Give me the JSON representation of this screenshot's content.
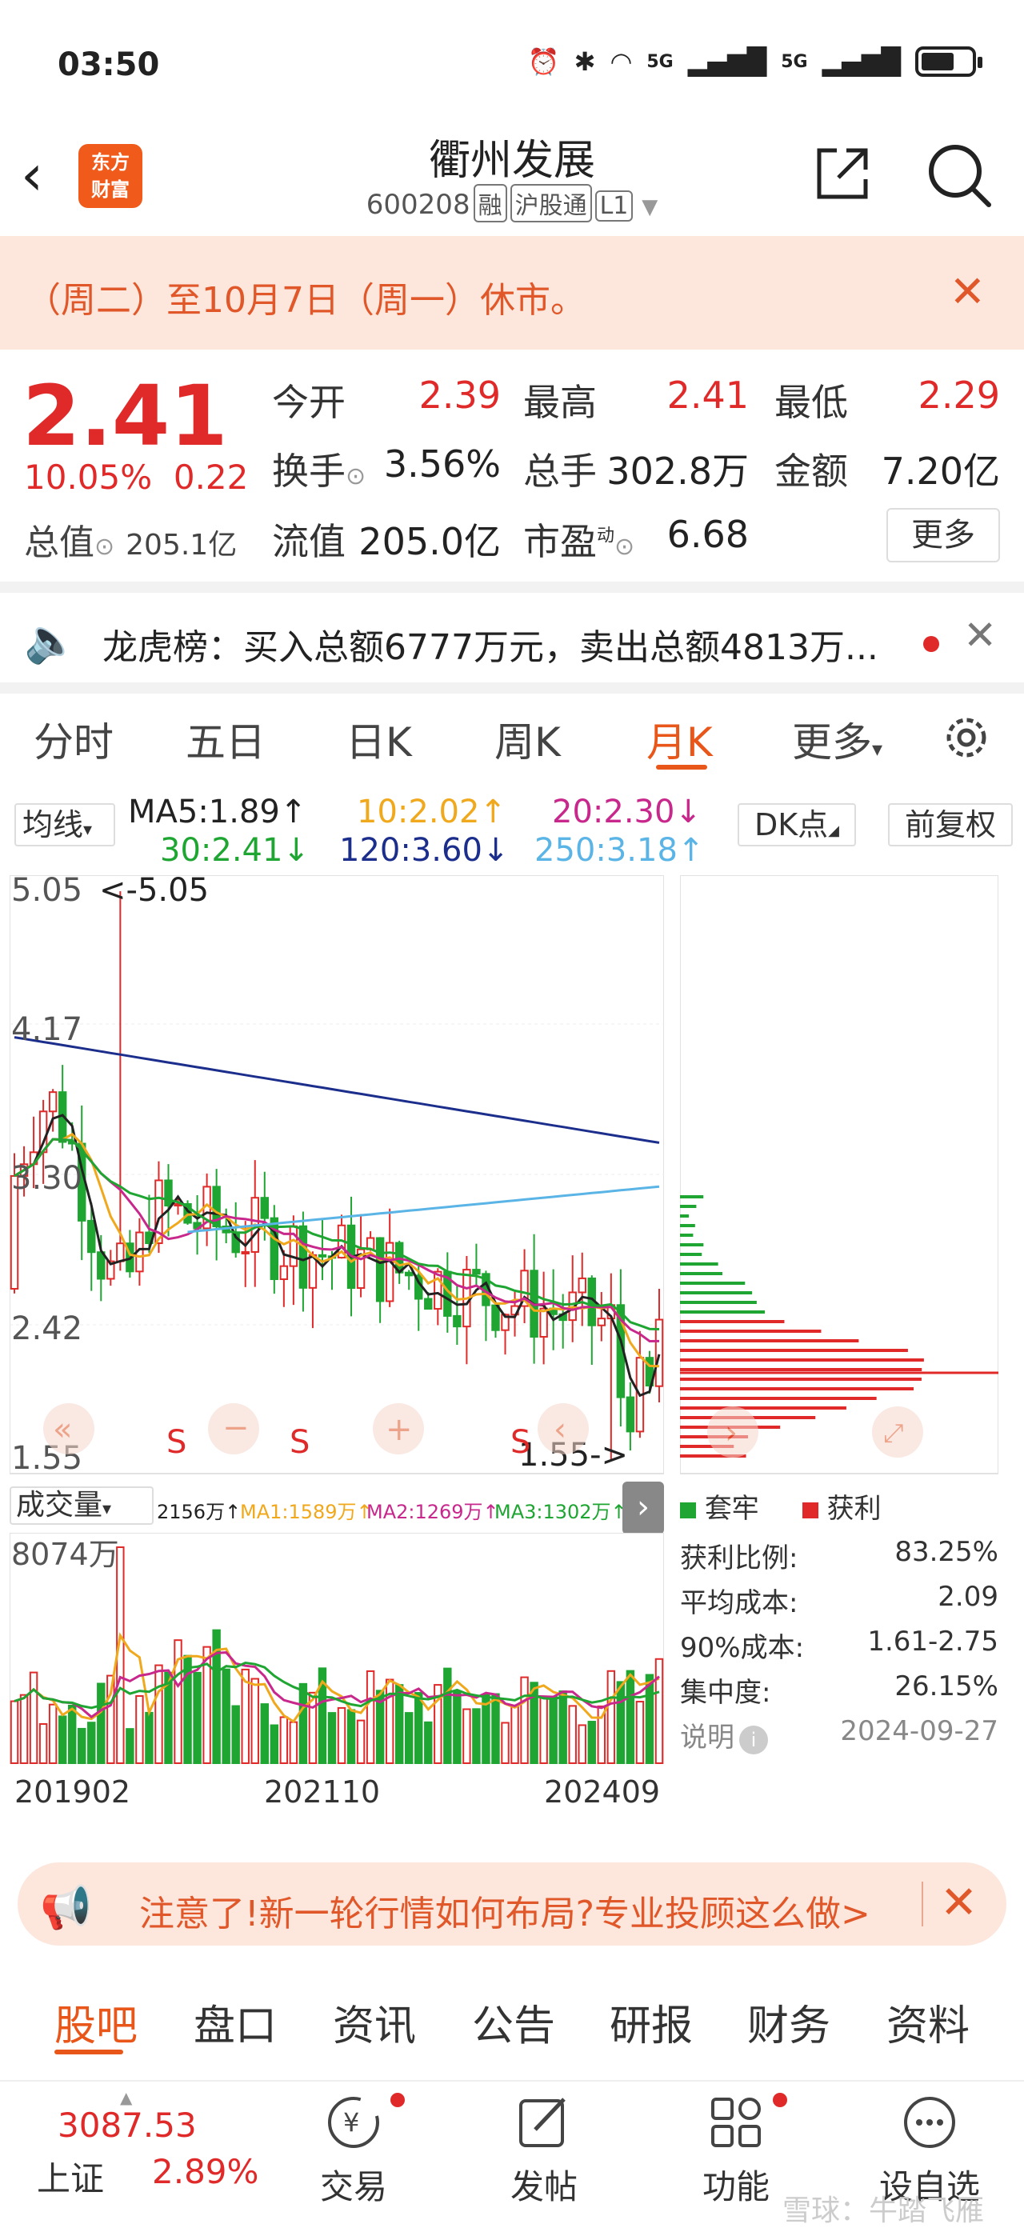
{
  "status_bar": {
    "time": "03:50",
    "network": "5G",
    "network2": "5G"
  },
  "header": {
    "logo": "东方\n财富",
    "name": "衢州发展",
    "code": "600208",
    "tags": [
      "融",
      "沪股通",
      "L1"
    ]
  },
  "notice": {
    "text": "（周二）至10月7日（周一）休市。"
  },
  "quote": {
    "price": "2.41",
    "change_pct": "10.05%",
    "change_abs": "0.22",
    "mktcap_label": "总值",
    "mktcap_value": "205.1亿",
    "fields": [
      {
        "label": "今开",
        "value": "2.39",
        "color": "#e02a2a"
      },
      {
        "label": "最高",
        "value": "2.41",
        "color": "#e02a2a"
      },
      {
        "label": "最低",
        "value": "2.29",
        "color": "#e02a2a"
      },
      {
        "label": "换手",
        "value": "3.56%",
        "color": "#222222"
      },
      {
        "label": "总手",
        "value": "302.8万",
        "color": "#222222"
      },
      {
        "label": "金额",
        "value": "7.20亿",
        "color": "#222222"
      },
      {
        "label": "流值",
        "value": "205.0亿",
        "color": "#222222"
      },
      {
        "label": "市盈",
        "value": "6.68",
        "color": "#222222",
        "sup": "动"
      }
    ],
    "more": "更多"
  },
  "dragon_tiger": {
    "text": "龙虎榜：买入总额6777万元，卖出总额4813万..."
  },
  "kline_tabs": {
    "tabs": [
      "分时",
      "五日",
      "日K",
      "周K",
      "月K",
      "更多"
    ],
    "active": "月K"
  },
  "ma_row": {
    "selector": "均线",
    "items": [
      {
        "text": "MA5:1.89↑",
        "color": "#222222"
      },
      {
        "text": "10:2.02↑",
        "color": "#f0a81c"
      },
      {
        "text": "20:2.30↓",
        "color": "#c8288c"
      },
      {
        "text": "30:2.41↓",
        "color": "#1fa532"
      },
      {
        "text": "120:3.60↓",
        "color": "#1c2e8c"
      },
      {
        "text": "250:3.18↑",
        "color": "#5ab4e6"
      }
    ],
    "dk_button": "DK点",
    "adjust_button": "前复权"
  },
  "kchart": {
    "y_labels": [
      "5.05",
      "4.17",
      "3.30",
      "2.42",
      "1.55"
    ],
    "max_mark": "<-5.05",
    "min_mark": "1.55->",
    "signal": "S"
  },
  "volume": {
    "selector": "成交量",
    "stats": [
      {
        "text": "2156万↑",
        "color": "#222222"
      },
      {
        "text": "MA1:1589万↑",
        "color": "#f0a81c"
      },
      {
        "text": "MA2:1269万↑",
        "color": "#c8288c"
      },
      {
        "text": "MA3:1302万↑",
        "color": "#1fa532"
      }
    ],
    "max_label": "8074万",
    "x_labels": [
      "201902",
      "202110",
      "202409"
    ]
  },
  "chips": {
    "legend_trapped": "套牢",
    "legend_profit": "获利",
    "stats": [
      {
        "label": "获利比例:",
        "value": "83.25%"
      },
      {
        "label": "平均成本:",
        "value": "2.09"
      },
      {
        "label": "90%成本:",
        "value": "1.61-2.75"
      },
      {
        "label": "集中度:",
        "value": "26.15%"
      },
      {
        "label": "说明",
        "value": "2024-09-27"
      }
    ]
  },
  "ad": {
    "text": "注意了!新一轮行情如何布局?专业投顾这么做>"
  },
  "bottom_tabs": {
    "tabs": [
      "股吧",
      "盘口",
      "资讯",
      "公告",
      "研报",
      "财务",
      "资料"
    ],
    "active": "股吧"
  },
  "nav": {
    "index_value": "3087.53",
    "index_name": "上证",
    "index_change": "2.89%",
    "items": [
      "交易",
      "发帖",
      "功能",
      "设自选"
    ],
    "watermark": "雪球：牛踏飞雁"
  },
  "colors": {
    "up": "#e02a2a",
    "down": "#1fa532",
    "accent": "#e8561a"
  }
}
